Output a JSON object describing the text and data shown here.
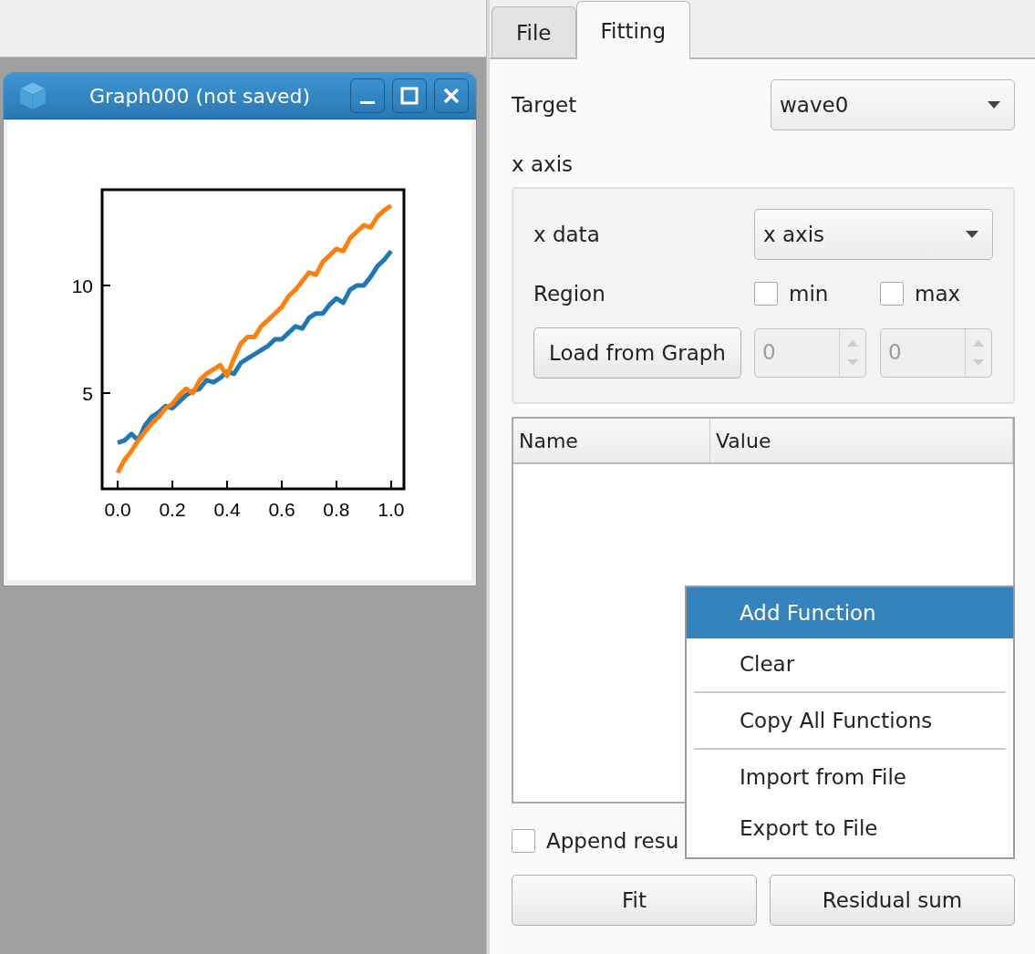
{
  "tabs": [
    {
      "label": "File",
      "selected": false
    },
    {
      "label": "Fitting",
      "selected": true
    }
  ],
  "graph_window": {
    "title": "Graph000 (not saved)",
    "chart_data": {
      "type": "line",
      "xlim": [
        -0.057,
        1.047
      ],
      "ylim": [
        0.55,
        14.45
      ],
      "xticks": [
        {
          "value": 0,
          "label": "0.0"
        },
        {
          "value": 0.2,
          "label": "0.2"
        },
        {
          "value": 0.4,
          "label": "0.4"
        },
        {
          "value": 0.6,
          "label": "0.6"
        },
        {
          "value": 0.8,
          "label": "0.8"
        },
        {
          "value": 1,
          "label": "1.0"
        }
      ],
      "yticks": [
        5,
        10
      ],
      "x": [
        0,
        0.025,
        0.05,
        0.075,
        0.1,
        0.125,
        0.15,
        0.175,
        0.2,
        0.225,
        0.25,
        0.275,
        0.3,
        0.325,
        0.35,
        0.375,
        0.4,
        0.425,
        0.45,
        0.475,
        0.5,
        0.525,
        0.55,
        0.575,
        0.6,
        0.625,
        0.65,
        0.675,
        0.7,
        0.725,
        0.75,
        0.775,
        0.8,
        0.825,
        0.85,
        0.875,
        0.9,
        0.925,
        0.95,
        0.975,
        1
      ],
      "series": [
        {
          "color": "#1f77b4",
          "values": [
            2.7,
            2.8,
            3.1,
            2.8,
            3.5,
            3.9,
            4.1,
            4.4,
            4.3,
            4.6,
            4.9,
            5.1,
            5.2,
            5.6,
            5.5,
            5.7,
            6.0,
            5.9,
            6.4,
            6.6,
            6.8,
            7.0,
            7.2,
            7.5,
            7.5,
            7.8,
            8.1,
            8.0,
            8.5,
            8.7,
            8.7,
            9.1,
            9.4,
            9.2,
            9.8,
            10.0,
            10.0,
            10.4,
            10.9,
            11.2,
            11.6
          ]
        },
        {
          "color": "#ff7f0e",
          "values": [
            1.3,
            1.9,
            2.3,
            2.8,
            3.2,
            3.6,
            3.9,
            4.3,
            4.5,
            4.9,
            5.2,
            5.0,
            5.6,
            5.9,
            6.1,
            6.3,
            5.8,
            6.6,
            7.3,
            7.6,
            7.6,
            8.1,
            8.4,
            8.7,
            9.0,
            9.5,
            9.8,
            10.2,
            10.6,
            10.5,
            11.1,
            11.4,
            11.7,
            11.6,
            12.2,
            12.5,
            12.8,
            12.7,
            13.2,
            13.5,
            13.7
          ]
        }
      ]
    }
  },
  "fitting": {
    "target": {
      "label": "Target",
      "value": "wave0"
    },
    "x_axis": {
      "title": "x axis",
      "x_data": {
        "label": "x data",
        "value": "x axis"
      },
      "region": {
        "label": "Region",
        "min": {
          "label": "min",
          "checked": false
        },
        "max": {
          "label": "max",
          "checked": false
        }
      },
      "load_button": "Load from Graph",
      "spin_min": {
        "value": "0",
        "disabled": true
      },
      "spin_max": {
        "value": "0",
        "disabled": true
      }
    },
    "table": {
      "columns": [
        "Name",
        "Value"
      ]
    },
    "append_result": {
      "label": "Append resu",
      "checked": false
    },
    "buttons": [
      "Fit",
      "Residual sum"
    ]
  },
  "context_menu": [
    {
      "kind": "item",
      "label": "Add Function",
      "selected": true
    },
    {
      "kind": "item",
      "label": "Clear",
      "selected": false
    },
    {
      "kind": "separator"
    },
    {
      "kind": "item",
      "label": "Copy All Functions",
      "selected": false
    },
    {
      "kind": "separator"
    },
    {
      "kind": "item",
      "label": "Import from File",
      "selected": false
    },
    {
      "kind": "item",
      "label": "Export to File",
      "selected": false
    }
  ]
}
